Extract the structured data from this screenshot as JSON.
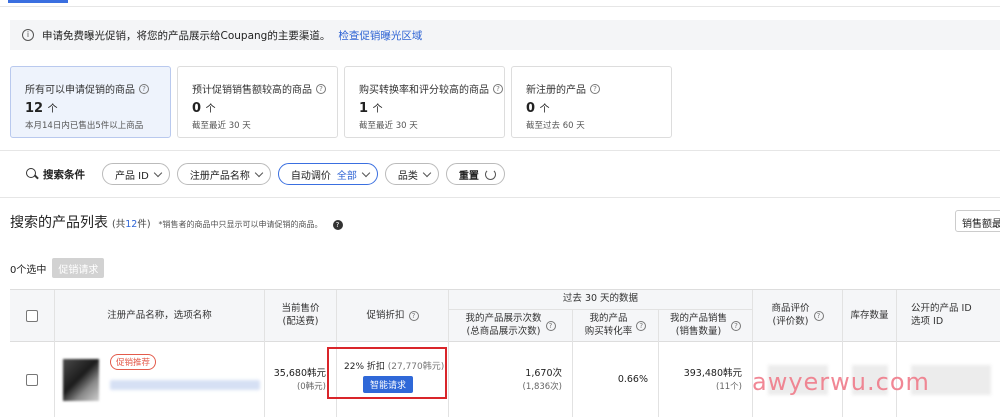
{
  "notice": {
    "text": "申请免费曝光促销，将您的产品展示给Coupang的主要渠道。",
    "link": "检查促销曝光区域"
  },
  "cards": [
    {
      "title": "所有可以申请促销的商品",
      "count": "12",
      "unit": "个",
      "sub": "本月14日内已售出5件以上商品"
    },
    {
      "title": "预计促销销售额较高的商品",
      "count": "0",
      "unit": "个",
      "sub": "截至最近 30 天"
    },
    {
      "title": "购买转换率和评分较高的商品",
      "count": "1",
      "unit": "个",
      "sub": "截至最近 30 天"
    },
    {
      "title": "新注册的产品",
      "count": "0",
      "unit": "个",
      "sub": "截至过去 60 天"
    }
  ],
  "filters": {
    "search_label": "搜索条件",
    "product_id": "产品 ID",
    "product_name": "注册产品名称",
    "auto_price": "自动调价",
    "auto_price_value": "全部",
    "category": "品类",
    "reset": "重置"
  },
  "list": {
    "title": "搜索的产品列表",
    "count_prefix": "(共",
    "count": "12",
    "count_suffix": "件)",
    "note": "*销售者的商品中只显示可以申请促销的商品。",
    "sort_label": "销售额最"
  },
  "selection": {
    "selected": "0个选中",
    "promo_button": "促销请求"
  },
  "table": {
    "headers": {
      "name": "注册产品名称，选项名称",
      "price_line1": "当前售价",
      "price_line2": "(配送费)",
      "discount": "促销折扣",
      "group": "过去 30 天的数据",
      "impressions_line1": "我的产品展示次数",
      "impressions_line2": "(总商品展示次数)",
      "conversion_line1": "我的产品",
      "conversion_line2": "购买转化率",
      "sales_line1": "我的产品销售",
      "sales_line2": "(销售数量)",
      "rating_line1": "商品评价",
      "rating_line2": "(评价数)",
      "stock": "库存数量",
      "public_id_line1": "公开的产品 ID",
      "public_id_line2": "选项 ID"
    },
    "rows": [
      {
        "badge": "促销推荐",
        "price": "35,680韩元",
        "shipping": "(0韩元)",
        "discount_pct": "22% 折扣",
        "discount_amount": "(27,770韩元)",
        "smart_button": "智能请求",
        "impressions": "1,670次",
        "total_impressions": "(1,836次)",
        "conversion": "0.66%",
        "sales": "393,480韩元",
        "sales_qty": "(11个)"
      }
    ]
  },
  "watermark": "awyerwu.com",
  "colors": {
    "accent": "#2f64d4",
    "highlight": "#d9252a",
    "badge": "#e35b4b"
  }
}
